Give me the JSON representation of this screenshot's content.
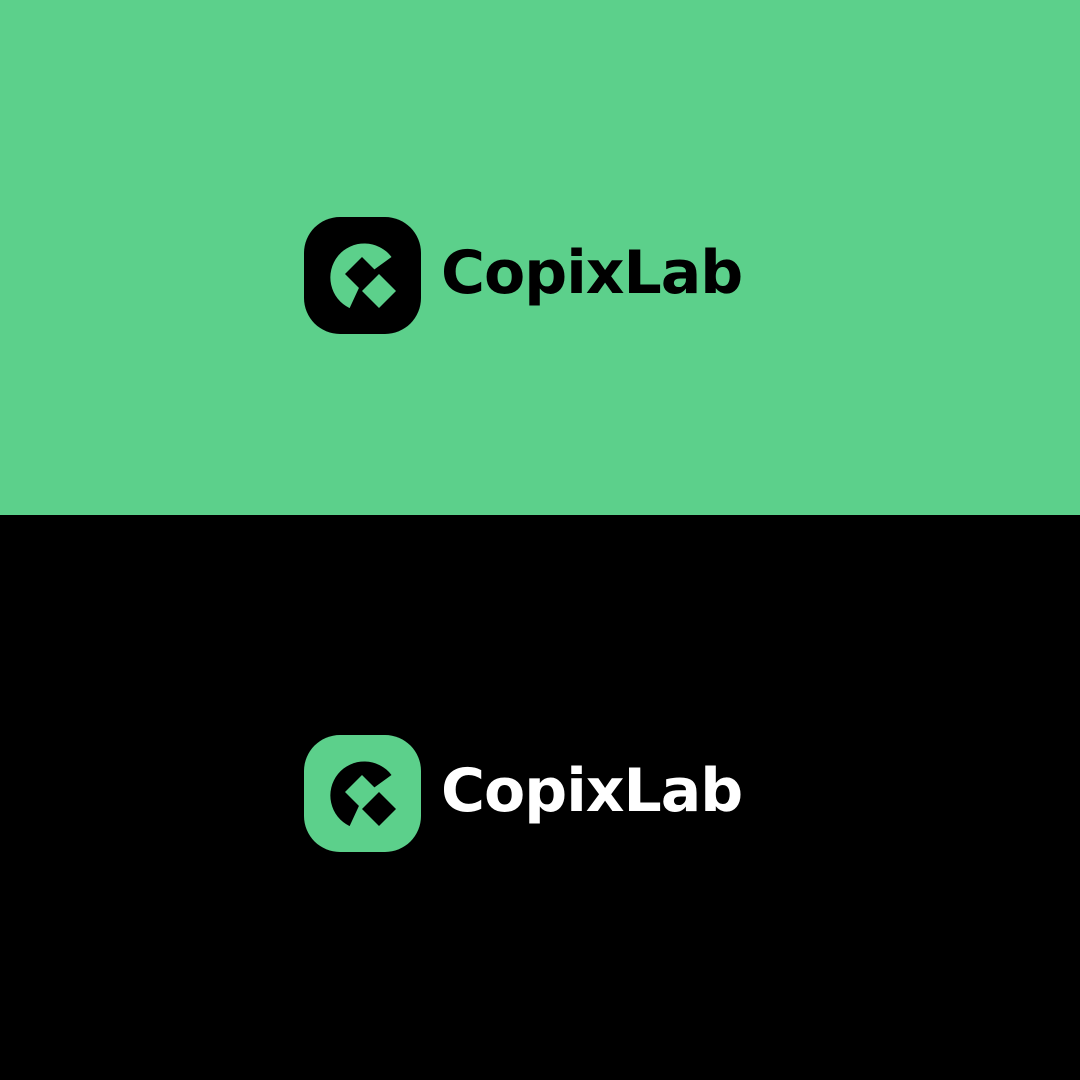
{
  "brand": {
    "name": "CopixLab"
  },
  "variants": [
    {
      "background": "#5cd08b",
      "icon_bg": "#000000",
      "icon_fg": "#5cd08b",
      "text_color": "#000000"
    },
    {
      "background": "#000000",
      "icon_bg": "#5cd08b",
      "icon_fg": "#000000",
      "text_color": "#ffffff"
    }
  ]
}
